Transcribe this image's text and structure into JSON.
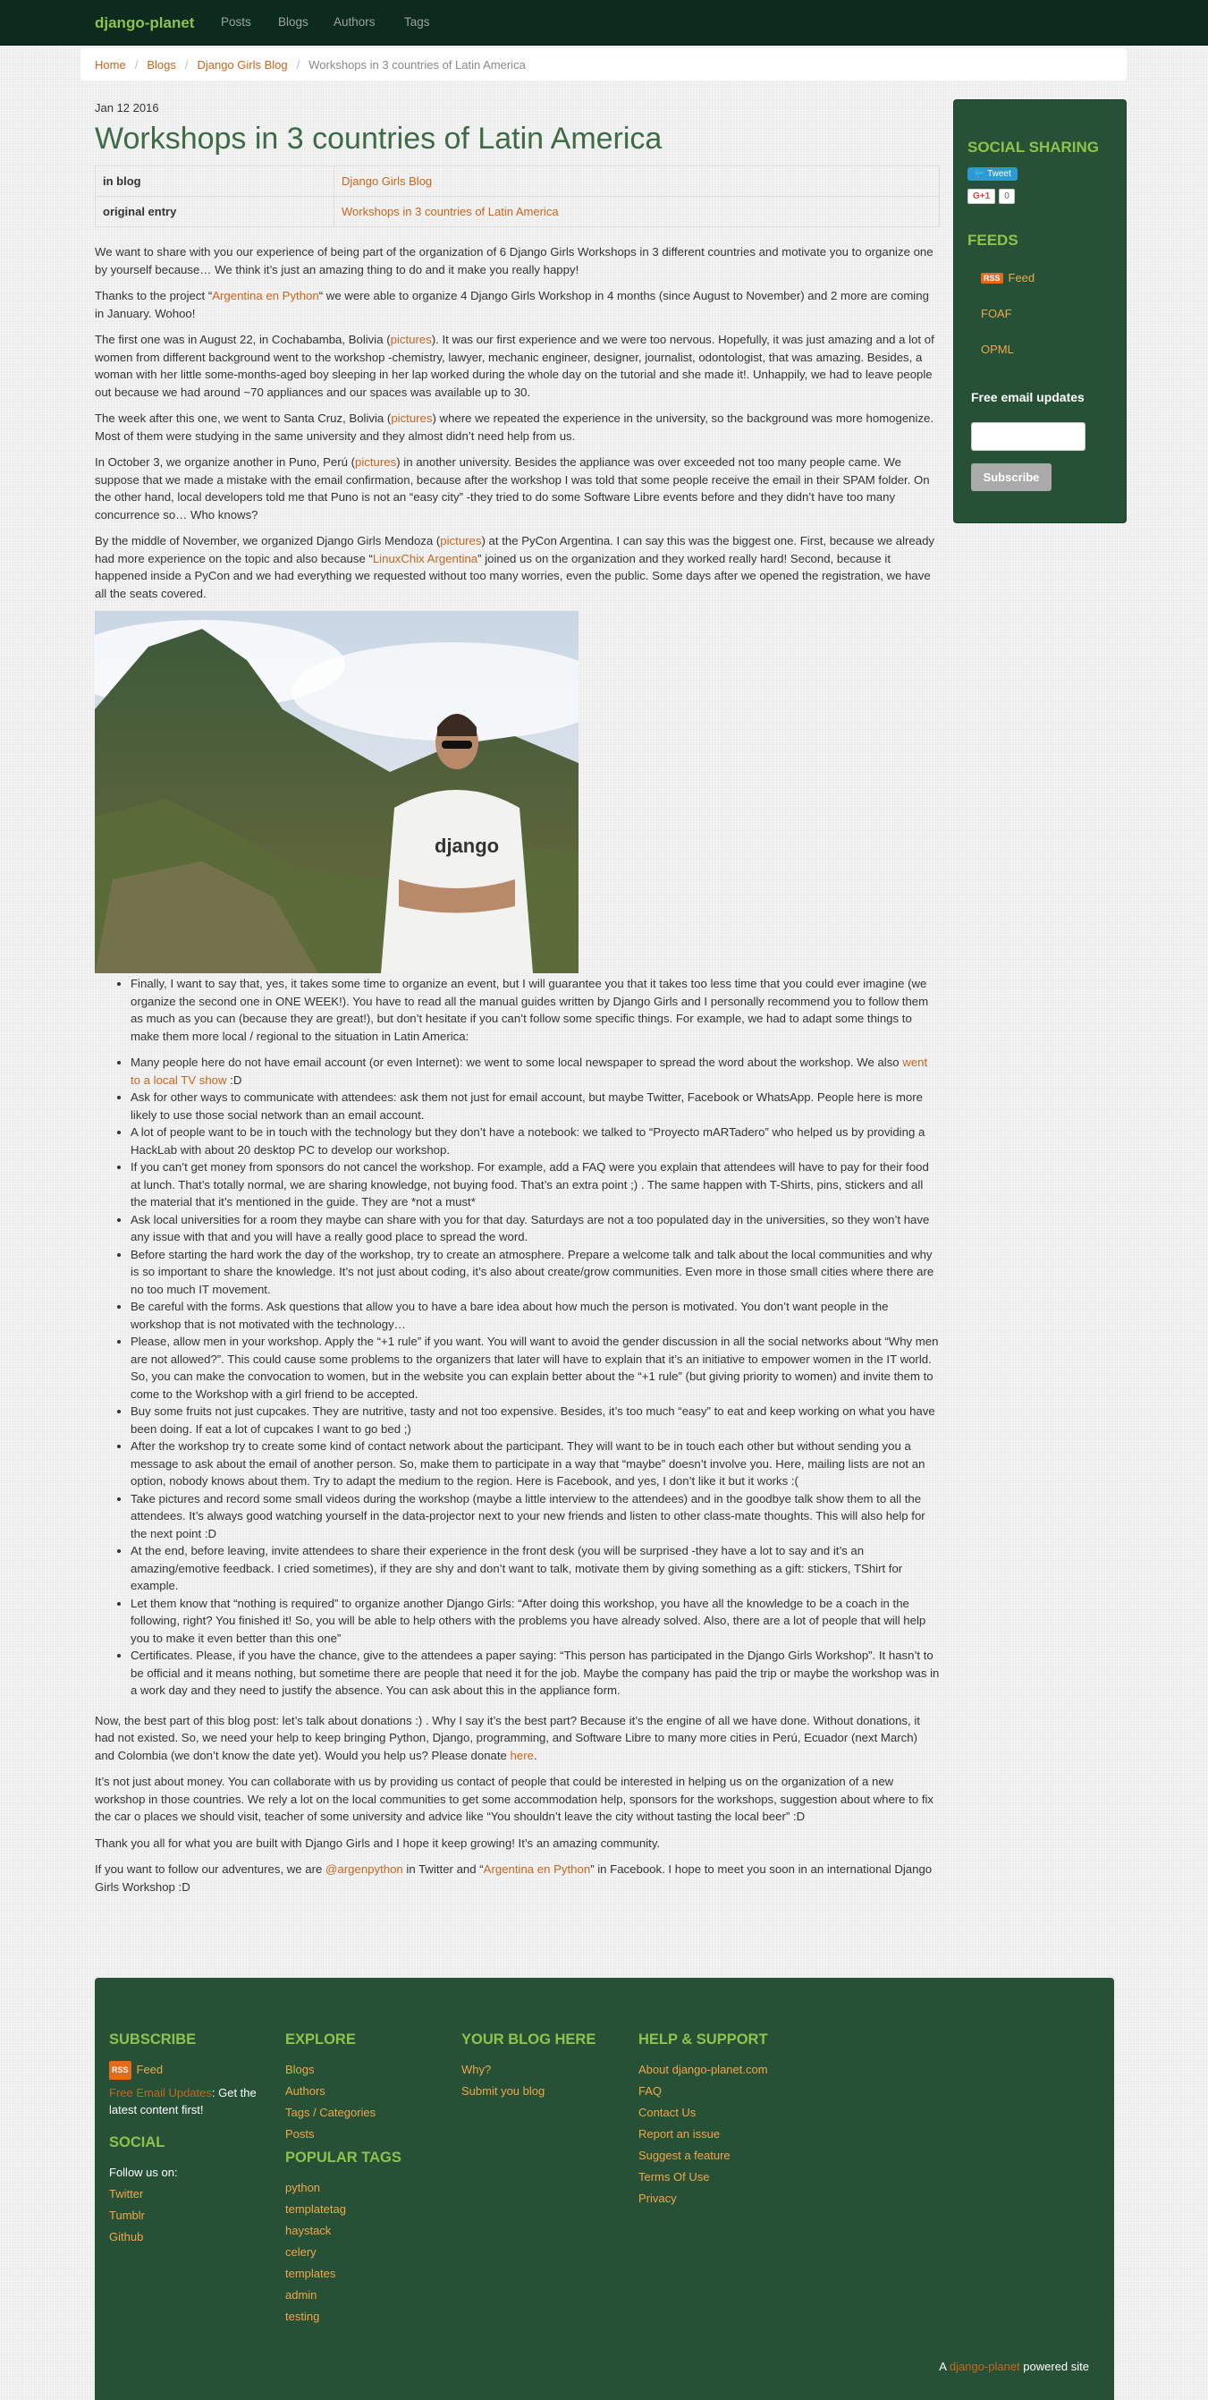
{
  "nav": {
    "brand": "django-planet",
    "links": [
      "Posts",
      "Blogs",
      "Authors",
      "Tags"
    ]
  },
  "breadcrumb": {
    "items": [
      "Home",
      "Blogs",
      "Django Girls Blog"
    ],
    "active": "Workshops in 3 countries of Latin America"
  },
  "post": {
    "date": "Jan 12 2016",
    "title": "Workshops in 3 countries of Latin America",
    "meta": [
      {
        "key": "in blog",
        "value": "Django Girls Blog"
      },
      {
        "key": "original entry",
        "value": "Workshops in 3 countries of Latin America"
      }
    ],
    "p1": "We want to share with you our experience of being part of the organization of 6 Django Girls Workshops in 3 different countries and motivate you to organize one by yourself because… We think it’s just an amazing thing to do and it make you really happy!",
    "p2": {
      "a": "Thanks to the project “",
      "link": "Argentina en Python",
      "b": "“ we were able to organize 4 Django Girls Workshop in 4 months (since August to November) and 2 more are coming in January. Wohoo!"
    },
    "p3": {
      "a": "The first one was in August 22, in Cochabamba, Bolivia (",
      "link": "pictures",
      "b": "). It was our first experience and we were too nervous. Hopefully, it was just amazing and a lot of women from different background went to the workshop -chemistry, lawyer, mechanic engineer, designer, journalist, odontologist, that was amazing. Besides, a woman with her little some-months-aged boy sleeping in her lap worked during the whole day on the tutorial and she made it!. Unhappily, we had to leave people out because we had around ~70 appliances and our spaces was available up to 30."
    },
    "p4": {
      "a": "The week after this one, we went to Santa Cruz, Bolivia (",
      "link": "pictures",
      "b": ") where we repeated the experience in the university, so the background was more homogenize. Most of them were studying in the same university and they almost didn’t need help from us."
    },
    "p5": {
      "a": "In October 3, we organize another in Puno, Perú (",
      "link": "pictures",
      "b": ") in another university. Besides the appliance was over exceeded not too many people came. We suppose that we made a mistake with the email confirmation, because after the workshop I was told that some people receive the email in their SPAM folder. On the other hand, local developers told me that Puno is not an “easy city” -they tried to do some Software Libre events before and they didn’t have too many concurrence so… Who knows?"
    },
    "p6": {
      "a": "By the middle of November, we organized Django Girls Mendoza (",
      "link": "pictures",
      "b": ") at the PyCon Argentina. I can say this was the biggest one. First, because we already had more experience on the topic and also because “",
      "link2": "LinuxChix Argentina",
      "c": "” joined us on the organization and they worked really hard! Second, because it happened inside a PyCon and we had everything we requested without too many worries, even the public. Some days after we opened the registration, we have all the seats covered."
    },
    "photo_shirt": "django",
    "li_first": "Finally, I want to say that, yes, it takes some time to organize an event, but I will guarantee you that it takes too less time that you could ever imagine (we organize the second one in ONE WEEK!). You have to read all the manual guides written by Django Girls and I personally recommend you to follow them as much as you can (because they are great!), but don’t hesitate if you can’t follow some specific things. For example, we had to adapt some things to make them more local / regional to the situation in Latin America:",
    "li_tv": {
      "a": "Many people here do not have email account (or even Internet): we went to some local newspaper to spread the word about the workshop. We also ",
      "link": "went to a local TV show",
      "b": " :D"
    },
    "tips": [
      "Ask for other ways to communicate with attendees: ask them not just for email account, but maybe Twitter, Facebook or WhatsApp. People here is more likely to use those social network than an email account.",
      "A lot of people want to be in touch with the technology but they don’t have a notebook: we talked to “Proyecto mARTadero” who helped us by providing a HackLab with about 20 desktop PC to develop our workshop.",
      "If you can’t get money from sponsors do not cancel the workshop. For example, add a FAQ were you explain that attendees will have to pay for their food at lunch. That’s totally normal, we are sharing knowledge, not buying food. That’s an extra point ;) . The same happen with T-Shirts, pins, stickers and all the material that it’s mentioned in the guide. They are *not a must*",
      "Ask local universities for a room they maybe can share with you for that day. Saturdays are not a too populated day in the universities, so they won’t have any issue with that and you will have a really good place to spread the word.",
      "Before starting the hard work the day of the workshop, try to create an atmosphere. Prepare a welcome talk and talk about the local communities and why is so important to share the knowledge. It’s not just about coding, it’s also about create/grow communities. Even more in those small cities where there are no too much IT movement.",
      "Be careful with the forms. Ask questions that allow you to have a bare idea about how much the person is motivated. You don’t want people in the workshop that is not motivated with the technology…",
      "Please, allow men in your workshop. Apply the “+1 rule” if you want. You will want to avoid the gender discussion in all the social networks about “Why men are not allowed?”. This could cause some problems to the organizers that later will have to explain that it’s an initiative to empower women in the IT world. So, you can make the convocation to women, but in the website you can explain better about the “+1 rule” (but giving priority to women) and invite them to come to the Workshop with a girl friend to be accepted.",
      "Buy some fruits not just cupcakes. They are nutritive, tasty and not too expensive. Besides, it’s too much “easy” to eat and keep working on what you have been doing. If eat a lot of cupcakes I want to go bed ;)",
      "After the workshop try to create some kind of contact network about the participant. They will want to be in touch each other but without sending you a message to ask about the email of another person. So, make them to participate in a way that “maybe” doesn’t involve you. Here, mailing lists are not an option, nobody knows about them. Try to adapt the medium to the region. Here is Facebook, and yes, I don’t like it but it works :(",
      "Take pictures and record some small videos during the workshop (maybe a little interview to the attendees) and in the goodbye talk show them to all the attendees. It’s always good watching yourself in the data-projector next to your new friends and listen to other class-mate thoughts. This will also help for the next point :D",
      "At the end, before leaving, invite attendees to share their experience in the front desk (you will be surprised -they have a lot to say and it’s an amazing/emotive feedback. I cried sometimes), if they are shy and don’t want to talk, motivate them by giving something as a gift: stickers, TShirt for example.",
      "Let them know that “nothing is required” to organize another Django Girls: “After doing this workshop, you have all the knowledge to be a coach in the following, right? You finished it! So, you will be able to help others with the problems you have already solved. Also, there are a lot of people that will help you to make it even better than this one”",
      "Certificates. Please, if you have the chance, give to the attendees a paper saying: “This person has participated in the Django Girls Workshop”. It hasn’t to be official and it means nothing, but sometime there are people that need it for the job. Maybe the company has paid the trip or maybe the workshop was in a work day and they need to justify the absence. You can ask about this in the appliance form."
    ],
    "p7": {
      "a": "Now, the best part of this blog post: let’s talk about donations :) . Why I say it’s the best part? Because it’s the engine of all we have done. Without donations, it had not existed. So, we need your help to keep bringing Python, Django, programming, and Software Libre to many more cities in Perú, Ecuador (next March) and Colombia (we don’t know the date yet). Would you help us? Please donate ",
      "link": "here",
      "b": "."
    },
    "p8": "It’s not just about money. You can collaborate with us by providing us contact of people that could be interested in helping us on the organization of a new workshop in those countries. We rely a lot on the local communities to get some accommodation help, sponsors for the workshops, suggestion about where to fix the car o places we should visit, teacher of some university and advice like “You shouldn’t leave the city without tasting the local beer” :D",
    "p9": "Thank you all for what you are built with Django Girls and I hope it keep growing! It’s an amazing community.",
    "p10": {
      "a": "If you want to follow our adventures, we are ",
      "link": "@argenpython",
      "b": " in Twitter and “",
      "link2": "Argentina en Python",
      "c": "” in Facebook. I hope to meet you soon in an international Django Girls Workshop :D"
    }
  },
  "sidebar": {
    "social_title": "SOCIAL SHARING",
    "tweet": "Tweet",
    "gplus": "G+1",
    "gplus_count": "0",
    "feeds_title": "FEEDS",
    "rss_badge": "RSS",
    "feed": "Feed",
    "foaf": "FOAF",
    "opml": "OPML",
    "email_title": "Free email updates",
    "subscribe": "Subscribe"
  },
  "footer": {
    "subscribe_title": "SUBSCRIBE",
    "rss_badge": "RSS",
    "feed": "Feed",
    "email_link": "Free Email Updates",
    "email_text": ": Get the latest content first!",
    "social_title": "SOCIAL",
    "follow": "Follow us on:",
    "social_links": [
      "Twitter",
      "Tumblr",
      "Github"
    ],
    "explore_title": "EXPLORE",
    "explore_links": [
      "Blogs",
      "Authors",
      "Tags / Categories",
      "Posts"
    ],
    "popular_title": "POPULAR TAGS",
    "tags": [
      "python",
      "templatetag",
      "haystack",
      "celery",
      "templates",
      "admin",
      "testing"
    ],
    "blog_title": "YOUR BLOG HERE",
    "blog_links": [
      "Why?",
      "Submit you blog"
    ],
    "help_title": "HELP & SUPPORT",
    "help_links": [
      "About django-planet.com",
      "FAQ",
      "Contact Us",
      "Report an issue",
      "Suggest a feature"
    ],
    "legal_links": [
      "Terms Of Use",
      "Privacy"
    ],
    "powered_a": "A ",
    "powered_link": "django-planet",
    "powered_b": " powered site"
  }
}
